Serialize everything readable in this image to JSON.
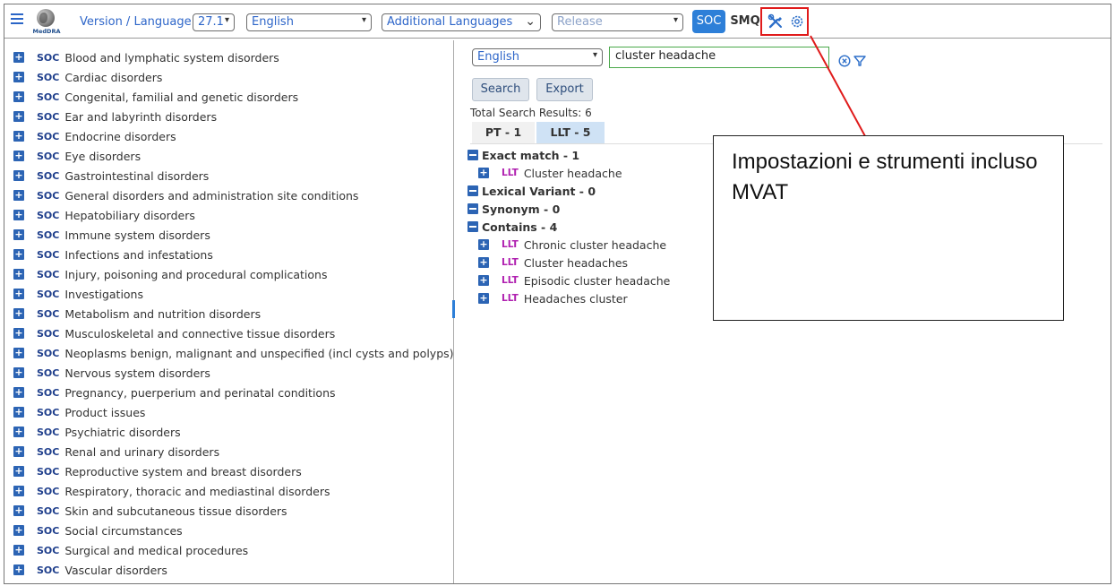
{
  "header": {
    "logo_text": "MedDRA",
    "version_label": "Version / Language",
    "version_value": "27.1",
    "language_value": "English",
    "additional_languages_label": "Additional Languages",
    "release_value": "Release",
    "soc_button": "SOC",
    "smq_button": "SMQ",
    "icons": [
      "menu-icon",
      "tools-icon",
      "gear-icon"
    ]
  },
  "soc_tree": {
    "tag": "SOC",
    "items": [
      "Blood and lymphatic system disorders",
      "Cardiac disorders",
      "Congenital, familial and genetic disorders",
      "Ear and labyrinth disorders",
      "Endocrine disorders",
      "Eye disorders",
      "Gastrointestinal disorders",
      "General disorders and administration site conditions",
      "Hepatobiliary disorders",
      "Immune system disorders",
      "Infections and infestations",
      "Injury, poisoning and procedural complications",
      "Investigations",
      "Metabolism and nutrition disorders",
      "Musculoskeletal and connective tissue disorders",
      "Neoplasms benign, malignant and unspecified (incl cysts and polyps)",
      "Nervous system disorders",
      "Pregnancy, puerperium and perinatal conditions",
      "Product issues",
      "Psychiatric disorders",
      "Renal and urinary disorders",
      "Reproductive system and breast disorders",
      "Respiratory, thoracic and mediastinal disorders",
      "Skin and subcutaneous tissue disorders",
      "Social circumstances",
      "Surgical and medical procedures",
      "Vascular disorders"
    ]
  },
  "search": {
    "language_value": "English",
    "query": "cluster headache",
    "search_button": "Search",
    "export_button": "Export",
    "total_results": "Total Search Results: 6",
    "tabs": [
      {
        "label": "PT - 1",
        "active": false
      },
      {
        "label": "LLT - 5",
        "active": true
      }
    ],
    "term_tag": "LLT",
    "groups": {
      "exact": {
        "label": "Exact match - 1",
        "items": [
          "Cluster headache"
        ]
      },
      "lexical": {
        "label": "Lexical Variant - 0"
      },
      "synonym": {
        "label": "Synonym - 0"
      },
      "contains": {
        "label": "Contains - 4",
        "items": [
          "Chronic cluster headache",
          "Cluster headaches",
          "Episodic cluster headache",
          "Headaches cluster"
        ]
      }
    }
  },
  "annotation": {
    "text": "Impostazioni e strumenti incluso MVAT",
    "highlight_color": "#e01b1b"
  },
  "colors": {
    "accent": "#2d7fd8",
    "soc_tag": "#1f3f8c",
    "llt_tag": "#b020b0",
    "search_border": "#4aa84a"
  }
}
